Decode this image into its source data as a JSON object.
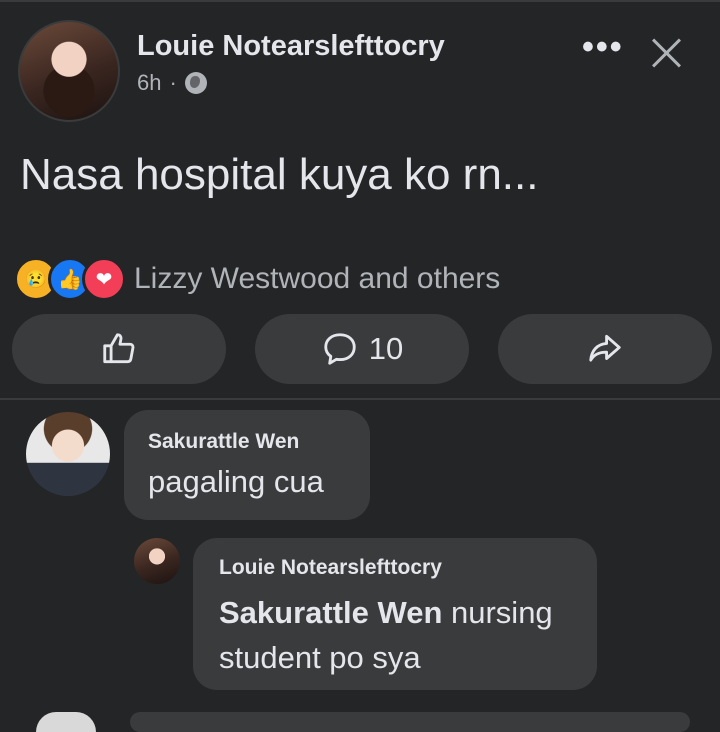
{
  "post": {
    "author": "Louie Notearslefttocry",
    "time": "6h",
    "dot": "·",
    "text": "Nasa hospital kuya ko rn...",
    "reaction_summary": "Lizzy Westwood and others",
    "comment_count": "10",
    "more_label": "•••"
  },
  "reactions": [
    {
      "type": "sad",
      "icon": "sad-reaction-icon",
      "glyph": "😢"
    },
    {
      "type": "like",
      "icon": "like-reaction-icon",
      "glyph": "👍"
    },
    {
      "type": "love",
      "icon": "love-reaction-icon",
      "glyph": "❤"
    }
  ],
  "comments": [
    {
      "author": "Sakurattle Wen",
      "text": "pagaling cua"
    },
    {
      "author": "Louie Notearslefttocry",
      "mention": "Sakurattle Wen",
      "text": " nursing student po sya"
    }
  ],
  "colors": {
    "background": "#242526",
    "surface": "#3a3b3c",
    "text_primary": "#e4e6eb",
    "text_secondary": "#b0b3b8"
  }
}
